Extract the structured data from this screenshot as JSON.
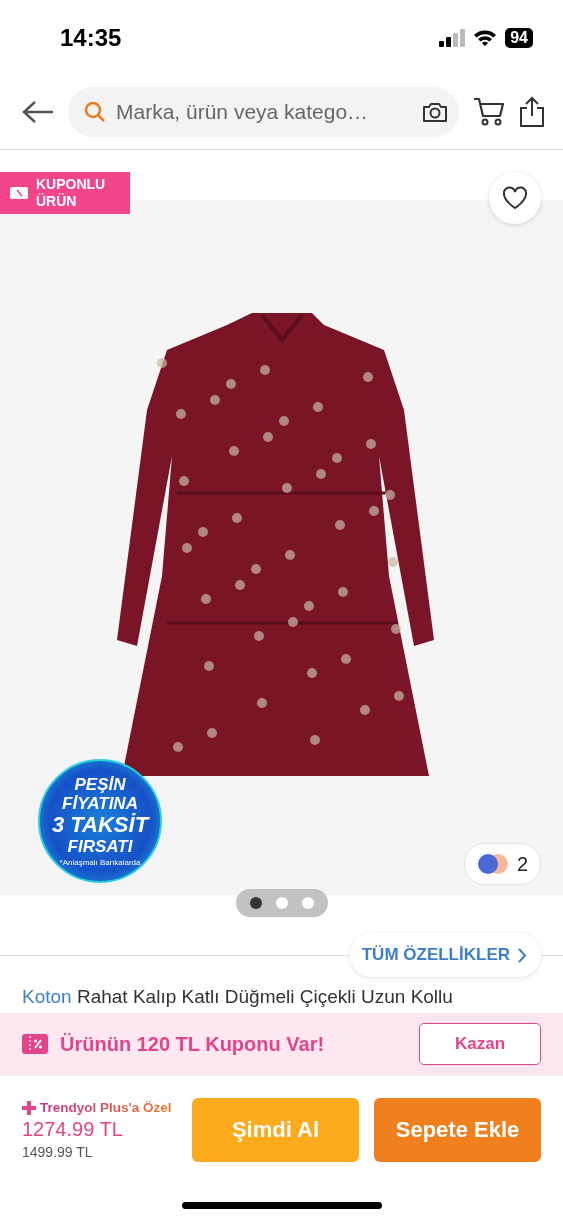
{
  "status_bar": {
    "time": "14:35",
    "battery": "94"
  },
  "search": {
    "placeholder": "Marka, ürün veya katego…"
  },
  "badge": {
    "label": "KUPONLU ÜRÜN"
  },
  "gallery": {
    "color_count": "2",
    "promo": {
      "lines": [
        "PEŞİN",
        "FİYATINA",
        "3 TAKSİT",
        "FIRSATI"
      ],
      "note": "*Anlaşmalı Bankalarda"
    },
    "dots": [
      {
        "selected": true
      },
      {
        "selected": false
      },
      {
        "selected": false
      }
    ]
  },
  "features_link": "TÜM ÖZELLİKLER",
  "title": {
    "brand": "Koton",
    "text": "Rahat Kalıp Katlı Düğmeli Çiçekli Uzun Kollu"
  },
  "coupon": {
    "text": "Ürünün 120 TL Kuponu Var!",
    "button": "Kazan"
  },
  "plus_label": "Trendyol Plus'a Özel",
  "price": "1274.99 TL",
  "old_price": "1499.99 TL",
  "buttons": [
    {
      "kind": "buy",
      "label": "Şimdi Al"
    },
    {
      "kind": "cart",
      "label": "Sepete Ekle"
    }
  ]
}
